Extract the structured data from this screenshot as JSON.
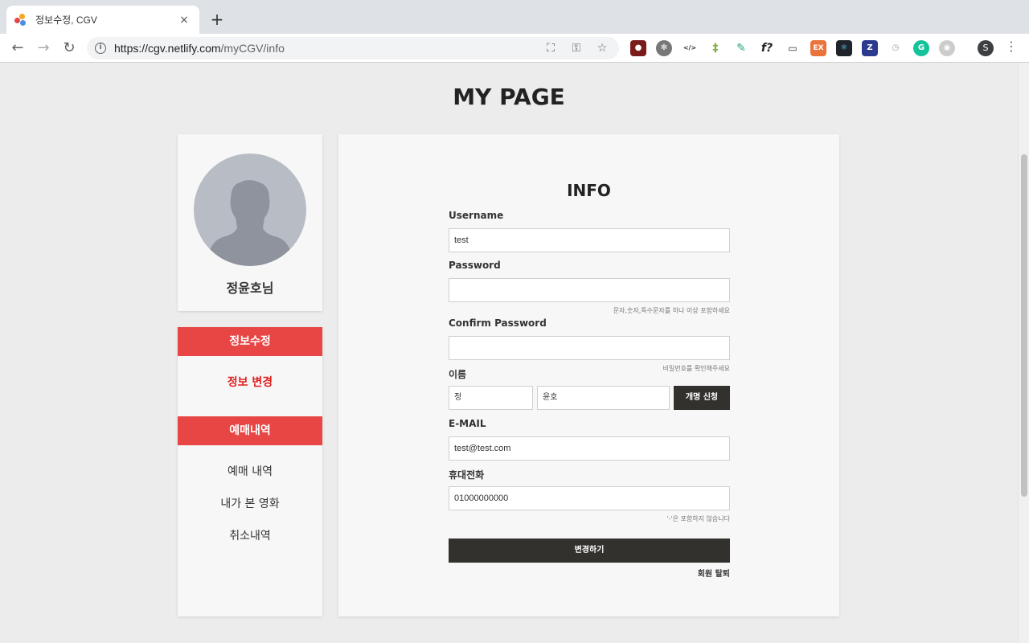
{
  "browser": {
    "tab_title": "정보수정, CGV",
    "tab_close": "×",
    "new_tab": "+",
    "url_host": "https://cgv.netlify.com",
    "url_path": "/myCGV/info",
    "profile_initial": "S",
    "extensions": [
      "spy-icon",
      "gear-icon",
      "code-icon",
      "ladder-icon",
      "eyedropper-icon",
      "f-icon",
      "cast-icon",
      "ex-icon",
      "react-icon",
      "z-icon",
      "clock-icon",
      "grammarly-icon",
      "discord-icon"
    ]
  },
  "page": {
    "title": "MY PAGE",
    "user_name": "정윤호님"
  },
  "sidebar": {
    "section1_header": "정보수정",
    "section1_items": [
      "정보 변경"
    ],
    "section2_header": "예매내역",
    "section2_items": [
      "예매 내역",
      "내가 본 영화",
      "취소내역"
    ]
  },
  "form": {
    "title": "INFO",
    "username_label": "Username",
    "username_value": "test",
    "password_label": "Password",
    "password_value": "",
    "password_hint": "문자,숫자,특수문자를 하나 이상 포함하세요",
    "confirm_label": "Confirm Password",
    "confirm_value": "",
    "confirm_hint": "비밀번호를 확인해주세요",
    "name_label": "이름",
    "last_name_value": "정",
    "first_name_value": "윤호",
    "rename_button": "개명 신청",
    "email_label": "E-MAIL",
    "email_value": "test@test.com",
    "phone_label": "휴대전화",
    "phone_value": "01000000000",
    "phone_hint": "'-'은 포함하지 않습니다",
    "submit_button": "변경하기",
    "withdraw_link": "회원 탈퇴"
  },
  "colors": {
    "accent": "#e84545",
    "active_text": "#e02020",
    "dark_button": "#33312e",
    "background": "#ececec",
    "card": "#f7f7f7"
  }
}
